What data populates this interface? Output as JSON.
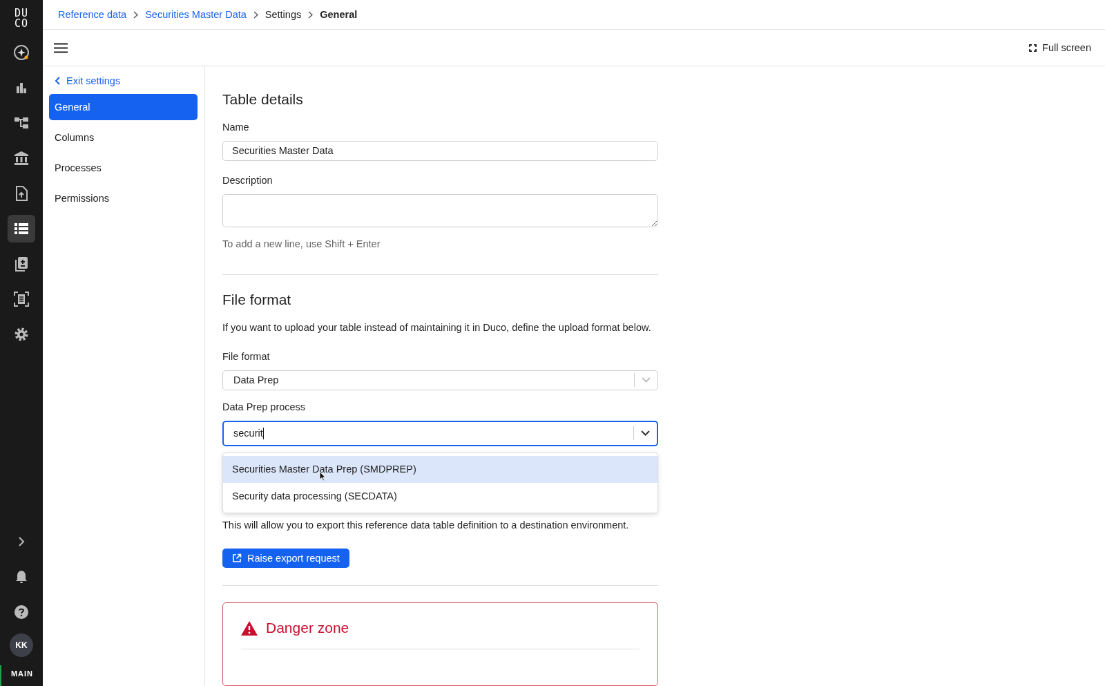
{
  "rail": {
    "logo": [
      "DU",
      "CO"
    ],
    "items": [
      {
        "selected": false
      },
      {
        "selected": false
      },
      {
        "selected": false
      },
      {
        "selected": false
      },
      {
        "selected": false
      },
      {
        "selected": true
      },
      {
        "selected": false
      },
      {
        "selected": false
      },
      {
        "selected": false
      }
    ],
    "avatar": "KK",
    "environment": "MAIN"
  },
  "breadcrumbs": [
    {
      "label": "Reference data",
      "link": true
    },
    {
      "label": "Securities Master Data",
      "link": true
    },
    {
      "label": "Settings",
      "link": false
    },
    {
      "label": "General",
      "link": false
    }
  ],
  "toolbar": {
    "full_screen": "Full screen"
  },
  "settings_nav": {
    "back": "Exit settings",
    "items": [
      {
        "label": "General",
        "selected": true
      },
      {
        "label": "Columns",
        "selected": false
      },
      {
        "label": "Processes",
        "selected": false
      },
      {
        "label": "Permissions",
        "selected": false
      }
    ]
  },
  "table_details": {
    "title": "Table details",
    "name_label": "Name",
    "name_value": "Securities Master Data",
    "description_label": "Description",
    "description_hint": "To add a new line, use Shift + Enter"
  },
  "file_format": {
    "title": "File format",
    "intro": "If you want to upload your table instead of maintaining it in Duco, define the upload format below.",
    "format_label": "File format",
    "format_value": "Data Prep",
    "process_label": "Data Prep process",
    "process_value": "securit",
    "options": [
      {
        "label": "Securities Master Data Prep (SMDPREP)",
        "selected": true
      },
      {
        "label": "Security data processing (SECDATA)",
        "selected": false
      }
    ]
  },
  "export": {
    "text": "This will allow you to export this reference data table definition to a destination environment.",
    "button": "Raise export request"
  },
  "danger_zone": {
    "title": "Danger zone"
  }
}
